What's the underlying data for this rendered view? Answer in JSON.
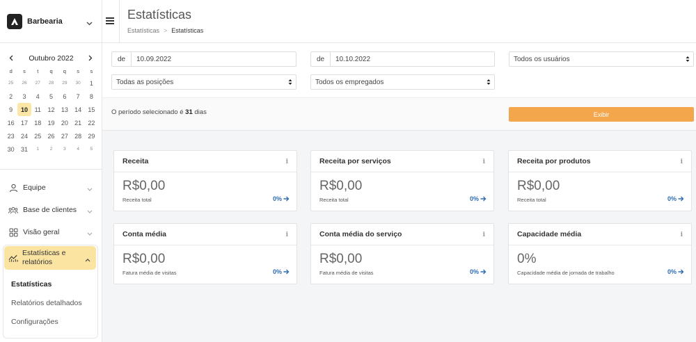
{
  "brand": {
    "name": "Barbearia"
  },
  "calendar": {
    "month_label": "Outubro 2022",
    "weekdays": [
      "d",
      "s",
      "t",
      "q",
      "q",
      "s",
      "s"
    ],
    "weeks": [
      [
        [
          "25",
          "out"
        ],
        [
          "26",
          "out"
        ],
        [
          "27",
          "out"
        ],
        [
          "28",
          "out"
        ],
        [
          "29",
          "out"
        ],
        [
          "30",
          "out"
        ],
        [
          "1",
          "in"
        ]
      ],
      [
        [
          "2",
          "in"
        ],
        [
          "3",
          "in"
        ],
        [
          "4",
          "in"
        ],
        [
          "5",
          "in"
        ],
        [
          "6",
          "in"
        ],
        [
          "7",
          "in"
        ],
        [
          "8",
          "in"
        ]
      ],
      [
        [
          "9",
          "in"
        ],
        [
          "10",
          "today"
        ],
        [
          "11",
          "in"
        ],
        [
          "12",
          "in"
        ],
        [
          "13",
          "in"
        ],
        [
          "14",
          "in"
        ],
        [
          "15",
          "in"
        ]
      ],
      [
        [
          "16",
          "in"
        ],
        [
          "17",
          "in"
        ],
        [
          "18",
          "in"
        ],
        [
          "19",
          "in"
        ],
        [
          "20",
          "in"
        ],
        [
          "21",
          "in"
        ],
        [
          "22",
          "in"
        ]
      ],
      [
        [
          "23",
          "in"
        ],
        [
          "24",
          "in"
        ],
        [
          "25",
          "in"
        ],
        [
          "26",
          "in"
        ],
        [
          "27",
          "in"
        ],
        [
          "28",
          "in"
        ],
        [
          "29",
          "in"
        ]
      ],
      [
        [
          "30",
          "in"
        ],
        [
          "31",
          "in"
        ],
        [
          "1",
          "out"
        ],
        [
          "2",
          "out"
        ],
        [
          "3",
          "out"
        ],
        [
          "4",
          "out"
        ],
        [
          "5",
          "out"
        ]
      ]
    ]
  },
  "nav": {
    "items": [
      {
        "label": "Equipe",
        "icon": "user-icon"
      },
      {
        "label": "Base de clientes",
        "icon": "users-icon"
      },
      {
        "label": "Visão geral",
        "icon": "grid-icon"
      }
    ],
    "active": {
      "label_line1": "Estatísticas e",
      "label_line2": "relatórios",
      "icon": "chart-icon"
    },
    "subitems": [
      "Estatísticas",
      "Relatórios detalhados",
      "Configurações"
    ]
  },
  "header": {
    "title": "Estatísticas",
    "breadcrumb": [
      "Estatísticas",
      "Estatísticas"
    ]
  },
  "filters": {
    "from_prefix": "de",
    "from_value": "10.09.2022",
    "to_prefix": "de",
    "to_value": "10.10.2022",
    "users_select": "Todos os usuários",
    "positions_select": "Todas as posições",
    "employees_select": "Todos os empregados"
  },
  "period": {
    "prefix": "O período selecionado é",
    "days": "31",
    "suffix": "dias",
    "button": "Exibir"
  },
  "cards": [
    {
      "title": "Receita",
      "value": "R$0,00",
      "sub": "Receita total",
      "pct": "0%"
    },
    {
      "title": "Receita por serviços",
      "value": "R$0,00",
      "sub": "Receita total",
      "pct": "0%"
    },
    {
      "title": "Receita por produtos",
      "value": "R$0,00",
      "sub": "Receita total",
      "pct": "0%"
    },
    {
      "title": "Conta média",
      "value": "R$0,00",
      "sub": "Fatura média de visitas",
      "pct": "0%"
    },
    {
      "title": "Conta média do serviço",
      "value": "R$0,00",
      "sub": "Fatura média de visitas",
      "pct": "0%"
    },
    {
      "title": "Capacidade média",
      "value": "0%",
      "sub": "Capacidade média de jornada de trabalho",
      "pct": "0%"
    }
  ],
  "info_glyph": "i",
  "colors": {
    "accent": "#f4a64c",
    "highlight": "#fbe3a2",
    "link": "#2f6db3"
  }
}
